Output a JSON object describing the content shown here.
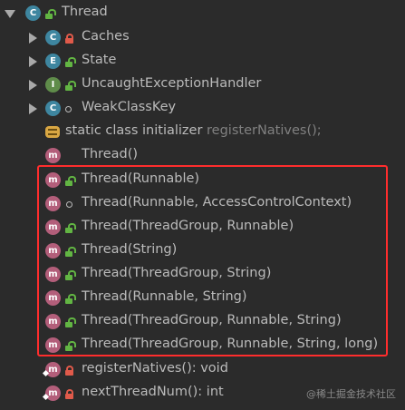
{
  "tree": {
    "root": {
      "label": "Thread",
      "icon": "class-icon"
    },
    "nested": [
      {
        "label": "Caches",
        "icon": "class-icon",
        "access": "private"
      },
      {
        "label": "State",
        "icon": "enum-icon",
        "access": "public"
      },
      {
        "label": "UncaughtExceptionHandler",
        "icon": "interface-icon",
        "access": "public"
      },
      {
        "label": "WeakClassKey",
        "icon": "class-icon",
        "access": "package"
      }
    ],
    "initializer": {
      "label": "static class initializer",
      "extra": "registerNatives();"
    },
    "methods": [
      {
        "label": "Thread()",
        "access": "none"
      },
      {
        "label": "Thread(Runnable)",
        "access": "public"
      },
      {
        "label": "Thread(Runnable, AccessControlContext)",
        "access": "package"
      },
      {
        "label": "Thread(ThreadGroup, Runnable)",
        "access": "public"
      },
      {
        "label": "Thread(String)",
        "access": "public"
      },
      {
        "label": "Thread(ThreadGroup, String)",
        "access": "public"
      },
      {
        "label": "Thread(Runnable, String)",
        "access": "public"
      },
      {
        "label": "Thread(ThreadGroup, Runnable, String)",
        "access": "public"
      },
      {
        "label": "Thread(ThreadGroup, Runnable, String, long)",
        "access": "public"
      },
      {
        "label": "registerNatives(): void",
        "access": "private-static"
      },
      {
        "label": "nextThreadNum(): int",
        "access": "private-static"
      }
    ]
  },
  "watermark": "@稀土掘金技术社区",
  "colors": {
    "background": "#2b2b2b",
    "text": "#bbbbbb",
    "highlight": "#ff2d2d"
  }
}
